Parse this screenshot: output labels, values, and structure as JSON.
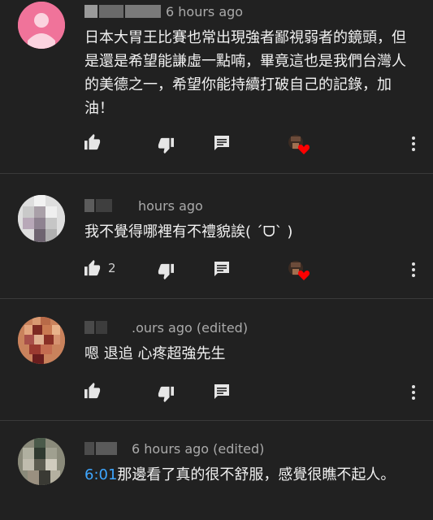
{
  "comments": [
    {
      "meta": "6 hours ago",
      "text": "日本大胃王比賽也常出現強者鄙視弱者的鏡頭，但是還是希望能謙虛一點喃，畢竟這也是我們台灣人的美德之一，希望你能持續打破自己的記錄，加油！",
      "likes": ""
    },
    {
      "meta": "hours ago",
      "text": "我不覺得哪裡有不禮貌誒( ˊᗜˋ )",
      "likes": "2"
    },
    {
      "meta": ".ours ago (edited)",
      "text": "嗯 退追 心疼超強先生",
      "likes": ""
    },
    {
      "meta": "6 hours ago (edited)",
      "timestamp_link": "6:01",
      "text": "那邊看了真的很不舒服，感覺很瞧不起人。",
      "likes": ""
    }
  ],
  "colors": {
    "background": "#212121",
    "link": "#3ea6ff",
    "heart": "#ff0000",
    "meta_text": "#aaaaaa"
  },
  "icons": [
    "thumb-up-icon",
    "thumb-down-icon",
    "reply-icon",
    "creator-heart-icon",
    "more-vert-icon"
  ]
}
